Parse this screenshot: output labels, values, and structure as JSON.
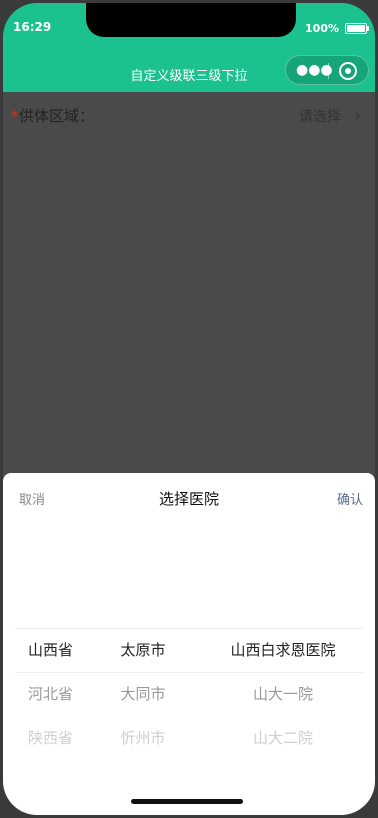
{
  "status": {
    "time": "16:29",
    "battery": "100%",
    "battery_level": 1.0
  },
  "nav": {
    "title": "自定义级联三级下拉",
    "menu_icon": "more-dots-icon",
    "close_icon": "target-close-icon"
  },
  "form": {
    "required": "*",
    "label": "供体区域：",
    "placeholder": "请选择",
    "chevron": "›"
  },
  "sheet": {
    "cancel": "取消",
    "title": "选择医院",
    "confirm": "确认",
    "columns": [
      [
        "山西省",
        "河北省",
        "陕西省"
      ],
      [
        "太原市",
        "大同市",
        "忻州市"
      ],
      [
        "山西白求恩医院",
        "山大一院",
        "山大二院"
      ]
    ]
  }
}
